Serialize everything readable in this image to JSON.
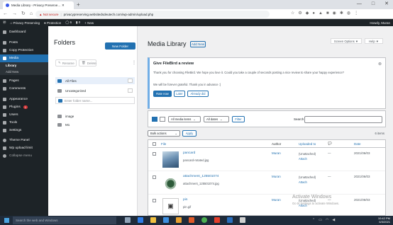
{
  "browser": {
    "tab_title": "Media Library ‹ Privacy Preserve… ✕",
    "new_tab": "+",
    "url_security": "▲ Not secure",
    "url": "privacypreserving.websitedsdeutech.com/wp-admin/upload.php",
    "window_controls": [
      "—",
      "□",
      "✕"
    ]
  },
  "adminbar": {
    "site": "Privacy Preserving",
    "protection": "Protection",
    "comments": "6",
    "updates": "0",
    "new": "+ New",
    "howdy": "Howdy, Muran"
  },
  "sidebar": {
    "items": [
      {
        "label": "Dashboard"
      },
      {
        "label": "Posts"
      },
      {
        "label": "Copy Protection"
      },
      {
        "label": "Media"
      },
      {
        "label": "Library"
      },
      {
        "label": "Add New"
      },
      {
        "label": "Pages"
      },
      {
        "label": "Comments"
      },
      {
        "label": "Appearance"
      },
      {
        "label": "Plugins"
      },
      {
        "label": "Users"
      },
      {
        "label": "Tools"
      },
      {
        "label": "Settings"
      },
      {
        "label": "Theme Panel"
      },
      {
        "label": "Wp upload limit"
      },
      {
        "label": "Collapse menu"
      }
    ],
    "plugins_badge": "1"
  },
  "folders": {
    "title": "Folders",
    "new_folder": "New Folder",
    "rename": "Rename",
    "delete": "Delete",
    "rows": [
      {
        "label": "All Files",
        "count": ""
      },
      {
        "label": "Uncategorized",
        "count": ""
      }
    ],
    "input_placeholder": "Enter folder name...",
    "folders": [
      {
        "label": "image"
      },
      {
        "label": "M1"
      }
    ]
  },
  "main": {
    "title": "Media Library",
    "add_new": "Add New",
    "screen_options": "Screen Options ▼",
    "help": "Help ▼",
    "notice": {
      "title": "Give FileBird a review",
      "p1": "Thank you for choosing FileBird. We hope you love it. Could you take a couple of seconds posting a nice review to share your happy experience?",
      "p2": "We will be forever grateful. Thank you in advance :)",
      "rate": "Rate now",
      "later": "Later",
      "rated": "Already did",
      "dismiss": "⊗"
    },
    "filters": {
      "media_items": "All media items",
      "dates": "All dates",
      "filter": "Filter",
      "search_label": "Search"
    },
    "bulk": {
      "actions": "Bulk actions",
      "apply": "Apply",
      "count": "6 items"
    },
    "table": {
      "headers": {
        "file": "File",
        "author": "Author",
        "uploaded_to": "Uploaded to",
        "comments": "💬",
        "date": "Date"
      },
      "rows": [
        {
          "name": "pancard",
          "file": "pancard-rotated.jpg",
          "author": "Muran",
          "uploaded": "(Unattached)",
          "attach": "Attach",
          "comments": "—",
          "date": "2021/06/03"
        },
        {
          "name": "attachment_125501074",
          "file": "attachment_125501074.jpg",
          "author": "Muran",
          "uploaded": "(Unattached)",
          "attach": "Attach",
          "comments": "—",
          "date": "2021/06/03"
        },
        {
          "name": "pin",
          "file": "pin.gif",
          "author": "Muran",
          "uploaded": "(Unattached)",
          "attach": "Attach",
          "comments": "—",
          "date": "2021/06/03"
        }
      ]
    }
  },
  "watermark": {
    "line1": "Activate Windows",
    "line2": "Go to Settings to activate Windows."
  },
  "taskbar": {
    "search": "Search the web and Windows",
    "time": "10:42 PM",
    "date": "6/3/2021"
  },
  "colors": {
    "wp_blue": "#2271b1",
    "admin_dark": "#1d2327",
    "notice_border": "#72aee6"
  }
}
